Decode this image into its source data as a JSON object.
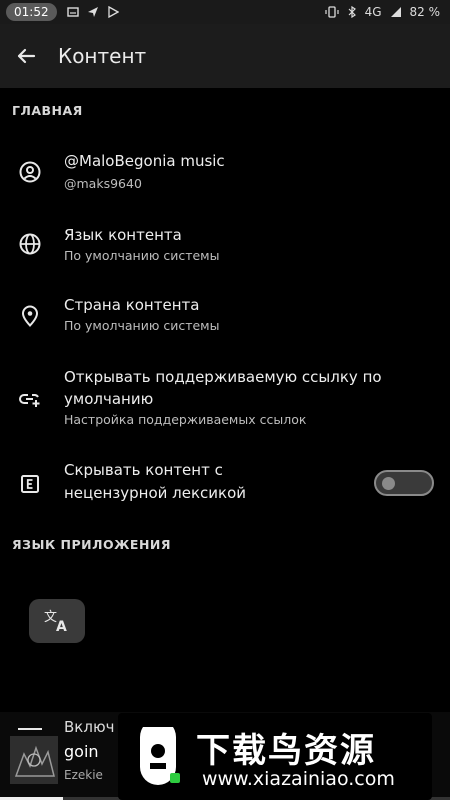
{
  "status_bar": {
    "time": "01:52",
    "network": "4G",
    "battery": "82 %"
  },
  "app_bar": {
    "title": "Контент",
    "back_icon": "arrow-left-icon"
  },
  "sections": {
    "main": "ГЛАВНАЯ",
    "app_language": "ЯЗЫК ПРИЛОЖЕНИЯ"
  },
  "items": [
    {
      "icon": "account-icon",
      "title": "@MaloBegonia music",
      "subtitle": "@maks9640"
    },
    {
      "icon": "globe-icon",
      "title": "Язык контента",
      "subtitle": "По умолчанию системы"
    },
    {
      "icon": "location-pin-icon",
      "title": "Страна контента",
      "subtitle": "По умолчанию системы"
    },
    {
      "icon": "open-link-icon",
      "title_line1": "Открывать поддерживаемую ссылку по",
      "title_line2": "умолчанию",
      "subtitle": "Настройка поддерживаемых ссылок"
    },
    {
      "icon": "explicit-icon",
      "title_line1": "Скрывать контент с",
      "title_line2": "нецензурной лексикой"
    }
  ],
  "toggle": {
    "explicit_enabled": false
  },
  "mini_player": {
    "peek_text": "Включ",
    "title": "goin",
    "artist": "Ezekie",
    "progress": 0.14
  },
  "watermark": {
    "cn_text": "下载鸟资源",
    "url": "www.xiazainiao.com"
  },
  "colors": {
    "background": "#000000",
    "app_bar": "#1c1c1c",
    "text_primary": "#eeeeee",
    "text_secondary": "#bdbdbd"
  }
}
